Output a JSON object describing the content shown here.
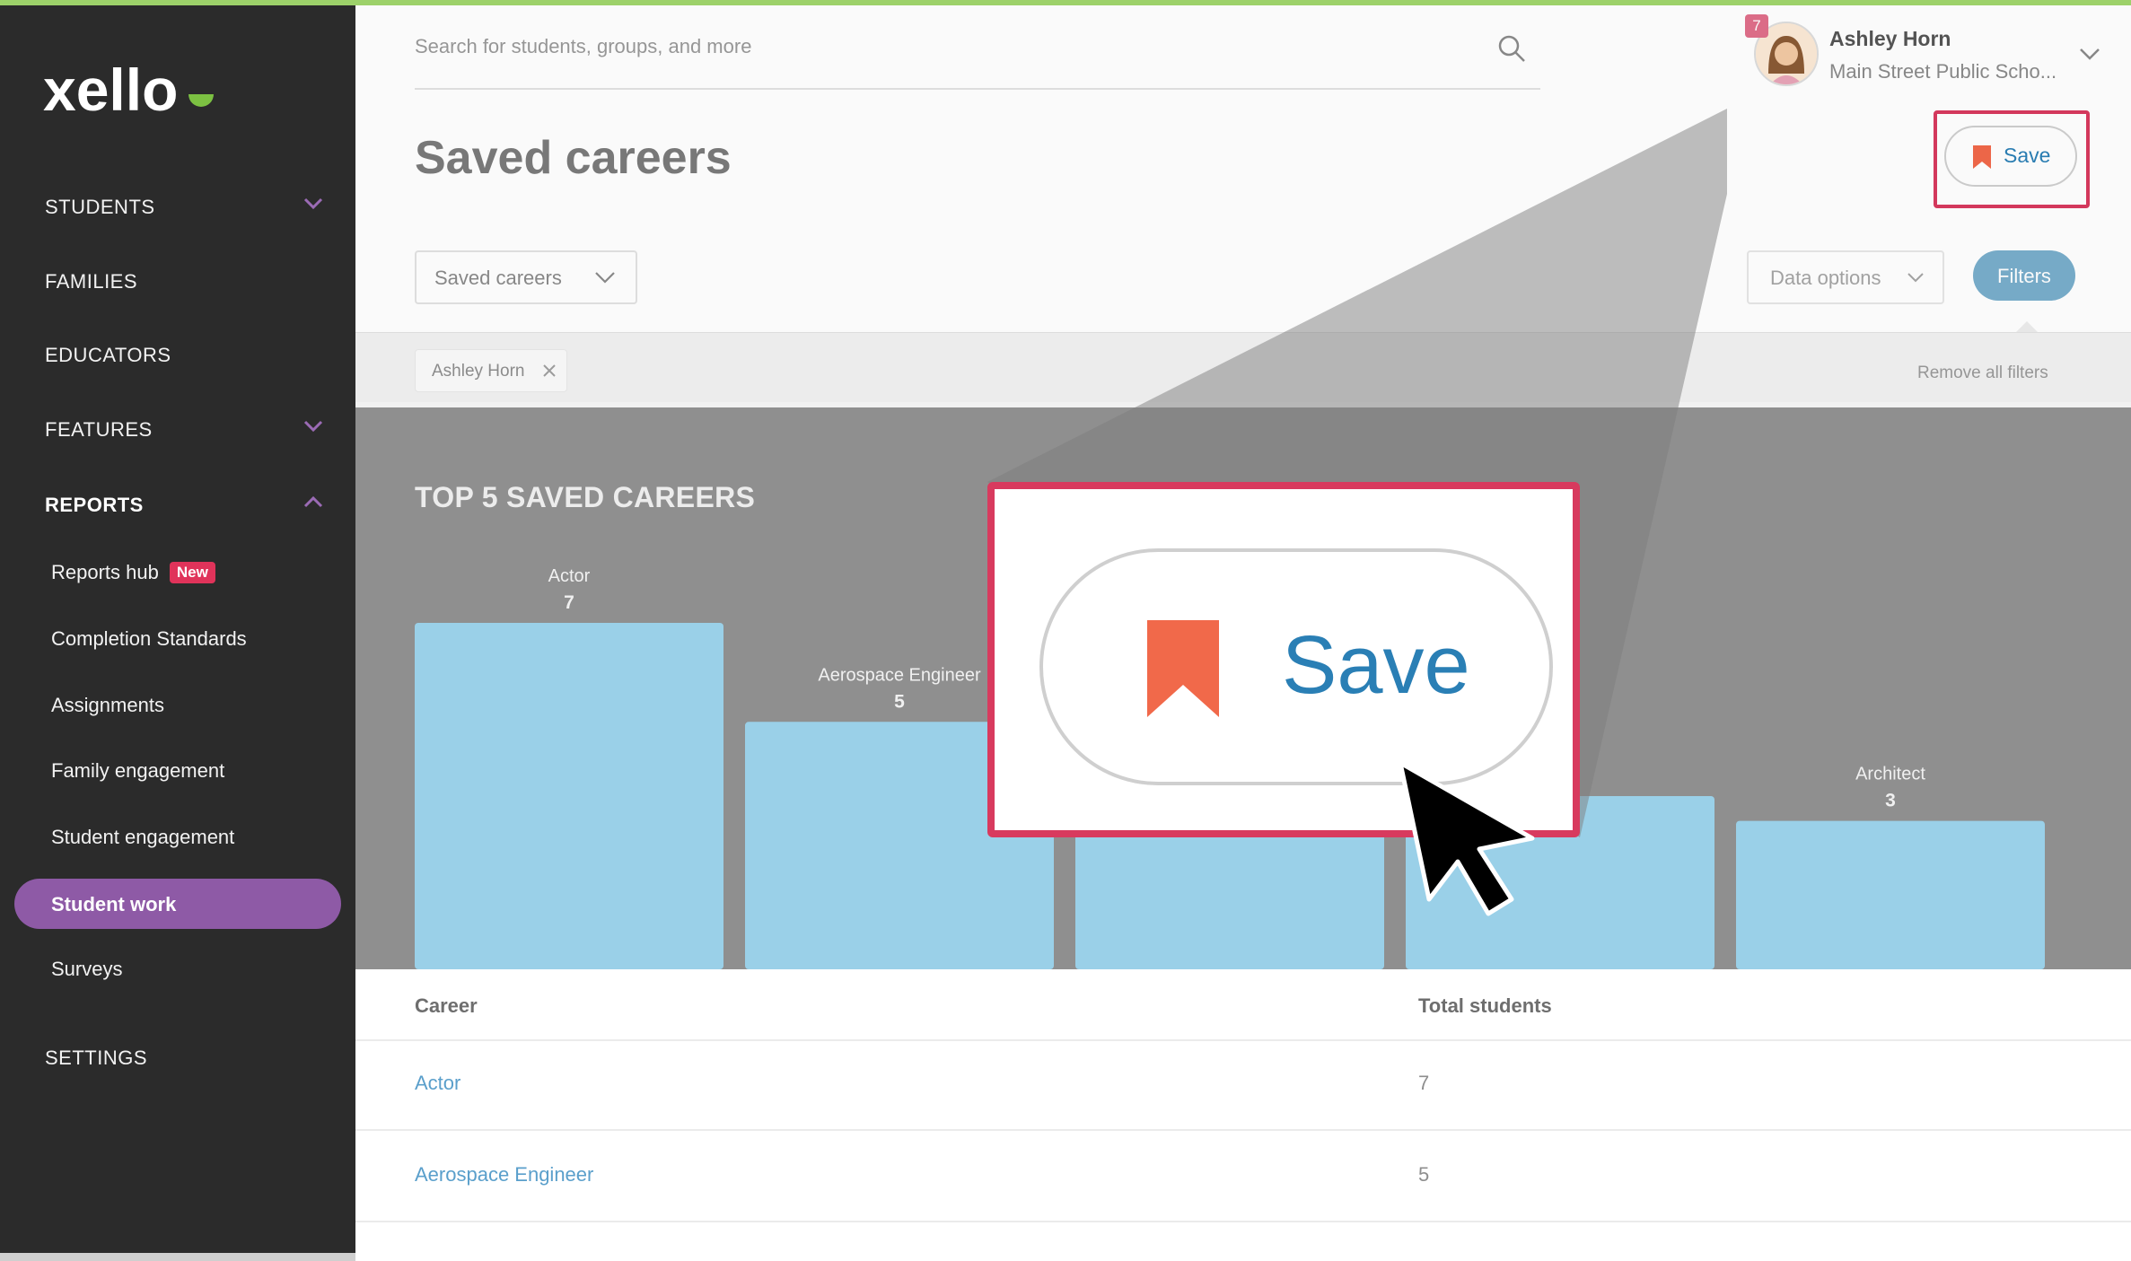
{
  "app": {
    "logo_text": "xello",
    "accent_color": "#9dd16a",
    "brand_purple": "#8e5aa6",
    "highlight_color": "#d83a5e"
  },
  "sidebar": {
    "items": [
      {
        "label": "STUDENTS",
        "has_chevron": true,
        "expanded": false
      },
      {
        "label": "FAMILIES"
      },
      {
        "label": "EDUCATORS"
      },
      {
        "label": "FEATURES",
        "has_chevron": true,
        "expanded": false
      },
      {
        "label": "REPORTS",
        "has_chevron": true,
        "expanded": true
      }
    ],
    "report_items": [
      {
        "label": "Reports hub",
        "badge": "New"
      },
      {
        "label": "Completion Standards"
      },
      {
        "label": "Assignments"
      },
      {
        "label": "Family engagement"
      },
      {
        "label": "Student engagement"
      },
      {
        "label": "Student work",
        "active": true
      },
      {
        "label": "Surveys"
      }
    ],
    "settings_label": "SETTINGS"
  },
  "header": {
    "search_placeholder": "Search for students, groups, and more",
    "notification_count": "7",
    "user_name": "Ashley Horn",
    "user_school": "Main Street Public Scho..."
  },
  "page": {
    "title": "Saved careers",
    "save_label": "Save",
    "report_dropdown": "Saved careers",
    "data_options_label": "Data options",
    "filters_label": "Filters",
    "filter_chip": "Ashley Horn",
    "remove_all_label": "Remove all filters"
  },
  "chart_data": {
    "type": "bar",
    "title": "TOP 5 SAVED CAREERS",
    "categories": [
      "Actor",
      "Aerospace Engineer",
      "",
      "",
      "Architect"
    ],
    "values": [
      7,
      5,
      null,
      null,
      3
    ],
    "ylim": [
      0,
      7
    ],
    "bar_color": "#9ad0e8"
  },
  "table": {
    "headers": [
      "Career",
      "Total students"
    ],
    "rows": [
      {
        "career": "Actor",
        "total": "7"
      },
      {
        "career": "Aerospace Engineer",
        "total": "5"
      }
    ]
  },
  "zoom": {
    "label": "Save"
  }
}
